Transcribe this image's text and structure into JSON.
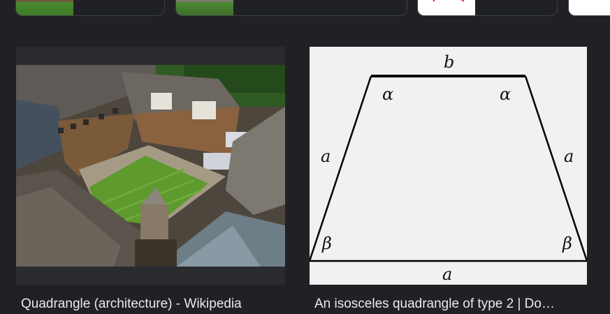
{
  "results": [
    {
      "caption": "Quadrangle (architecture) - Wikipedia",
      "image": "aerial photo of a college quadrangle with a green lawn"
    },
    {
      "caption": "An isosceles quadrangle of type 2 | Do…",
      "image": "isosceles trapezoid diagram",
      "labels": {
        "top": "b",
        "bottom": "a",
        "left": "a",
        "right": "a",
        "top_left_angle": "α",
        "top_right_angle": "α",
        "bottom_left_angle": "β",
        "bottom_right_angle": "β"
      }
    }
  ],
  "related_chips": [
    {
      "image": "campus-photo"
    },
    {
      "image": "road-photo"
    },
    {
      "image": "red-line-diagram"
    },
    {
      "image": "flexibility-logo"
    }
  ]
}
